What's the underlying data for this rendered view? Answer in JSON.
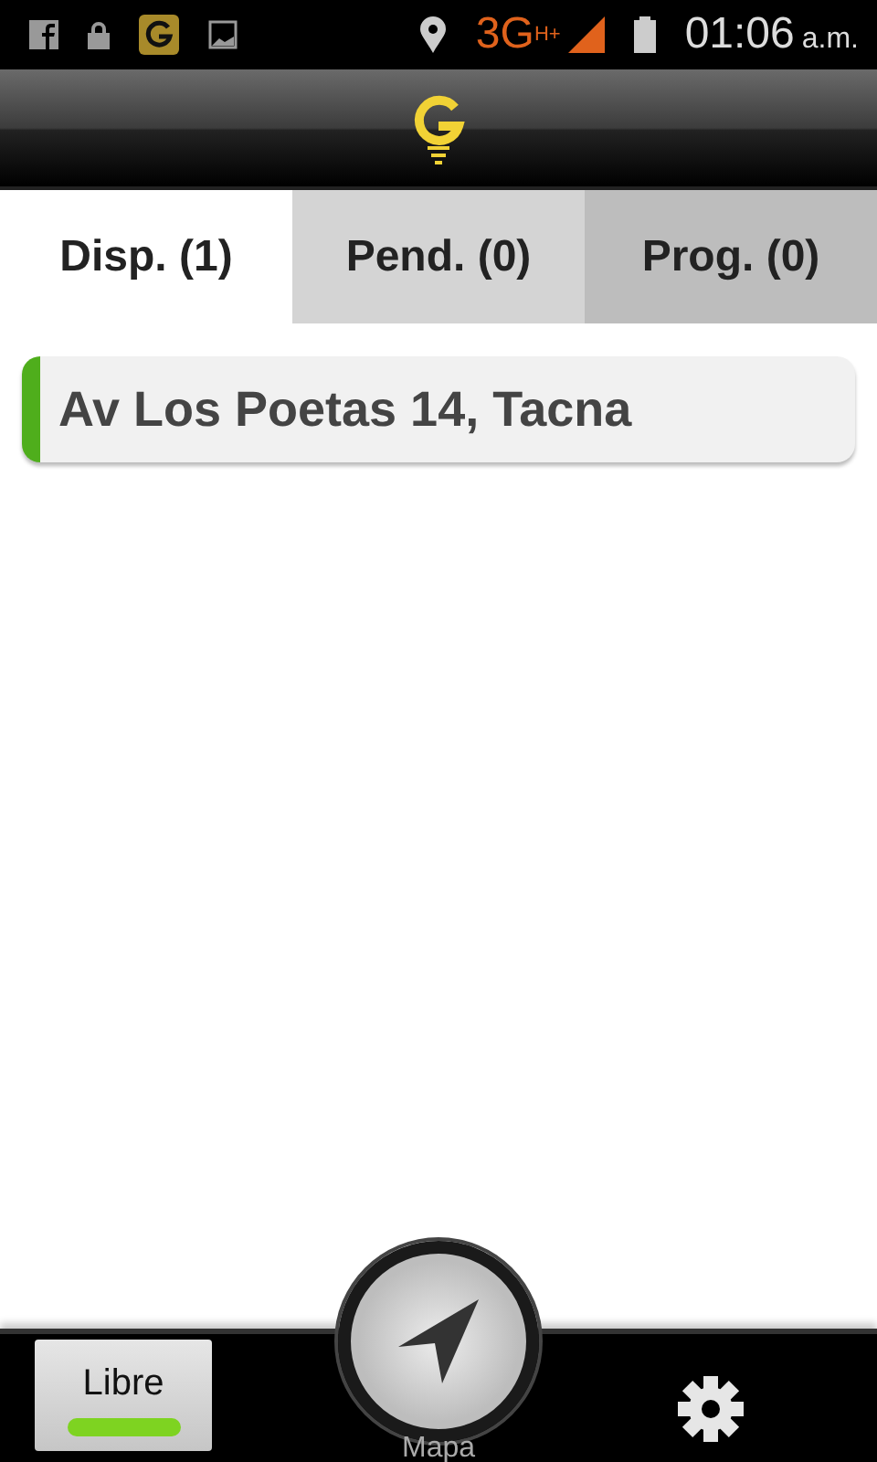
{
  "status_bar": {
    "network": "3G",
    "network_sub": "H+",
    "time": "01:06",
    "time_suffix": "a.m."
  },
  "tabs": [
    {
      "label": "Disp. (1)",
      "selected": true
    },
    {
      "label": "Pend. (0)",
      "selected": false
    },
    {
      "label": "Prog. (0)",
      "selected": false
    }
  ],
  "items": [
    {
      "address": "Av Los Poetas 14, Tacna",
      "color": "#4fae1c"
    }
  ],
  "bottom_bar": {
    "status": {
      "label": "Libre",
      "color": "#7ed321"
    },
    "map_label": "Mapa"
  }
}
